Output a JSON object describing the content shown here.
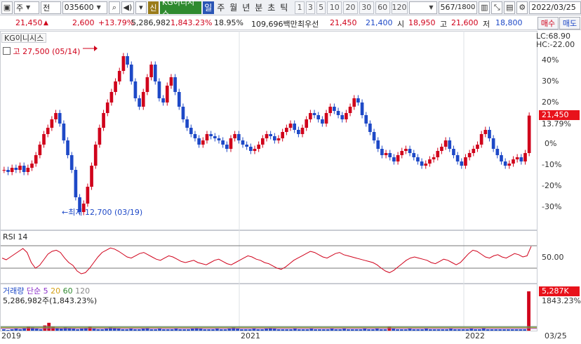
{
  "toolbar": {
    "market": "주",
    "scope": "전",
    "code": "035600",
    "badge": "신",
    "name": "KG이니시스",
    "timeframes": [
      "일",
      "주",
      "월",
      "년",
      "분",
      "초",
      "틱"
    ],
    "active_timeframe": "일",
    "periods": [
      "1",
      "3",
      "5",
      "10",
      "20",
      "30",
      "60",
      "120"
    ],
    "counter": "567",
    "counter_total": "/1800",
    "date": "2022/03/25"
  },
  "quote": {
    "price": "21,450",
    "arrow": "▲",
    "change": "2,600",
    "change_pct": "+13.79%",
    "volume": "5,286,982",
    "volume_ratio": "1,843.23%",
    "turnover": "18.95%",
    "amount": "109,696백만",
    "best_label": "최우선",
    "best_ask": "21,450",
    "best_bid": "21,400",
    "open_label": "시",
    "open": "18,950",
    "high_label": "고",
    "high": "21,600",
    "low_label": "저",
    "low": "18,800",
    "buy_label": "매수",
    "sell_label": "매도"
  },
  "chart": {
    "title": "KG이니시스",
    "lc_label": "LC:68.90",
    "hc_label": "HC:-22.00",
    "high_note": "고 27,500 (05/14)",
    "low_note": "최저 12,700 (03/19)",
    "price_tag": "21,450",
    "price_pct": "13.79%",
    "price_ticks": [
      "40%",
      "30%",
      "20%",
      "10%",
      "0%",
      "-10%",
      "-20%",
      "-30%"
    ],
    "rsi_label": "RSI 14",
    "rsi_tick": "50.00",
    "volume_label": "거래량",
    "ma_label": "단순",
    "ma_periods": [
      "5",
      "20",
      "60",
      "120"
    ],
    "volume_text": "5,286,982주(1,843.23%)",
    "vol_tag": "5,287K",
    "vol_pct": "1843.23%",
    "dates": [
      "2019",
      "2021",
      "2022",
      "03/25"
    ],
    "colors": {
      "up": "#d0021b",
      "down": "#1e49c7",
      "rsi": "#d0021b",
      "ma5": "#8b2fc9",
      "ma20": "#d4a017",
      "ma60": "#2f8a2f",
      "ma120": "#888888"
    }
  },
  "chart_data": {
    "type": "candlestick",
    "price_percent_series": [
      -12,
      -13,
      -11,
      -12,
      -10,
      -13,
      -11,
      -9,
      -5,
      0,
      5,
      8,
      12,
      15,
      10,
      2,
      -5,
      -12,
      -25,
      -32,
      -28,
      -20,
      -10,
      0,
      8,
      15,
      20,
      25,
      30,
      35,
      42,
      38,
      30,
      22,
      18,
      25,
      32,
      38,
      30,
      22,
      20,
      28,
      32,
      25,
      18,
      12,
      8,
      5,
      3,
      0,
      2,
      5,
      4,
      3,
      2,
      0,
      -2,
      3,
      5,
      2,
      0,
      -1,
      -3,
      -2,
      0,
      3,
      5,
      4,
      2,
      3,
      6,
      8,
      10,
      7,
      5,
      8,
      12,
      15,
      14,
      12,
      10,
      15,
      18,
      16,
      14,
      12,
      15,
      18,
      22,
      20,
      14,
      10,
      6,
      2,
      -2,
      -5,
      -4,
      -6,
      -8,
      -5,
      -3,
      -2,
      -4,
      -6,
      -8,
      -10,
      -9,
      -7,
      -6,
      -3,
      -1,
      2,
      -2,
      -5,
      -8,
      -10,
      -6,
      -4,
      -2,
      0,
      5,
      7,
      3,
      -2,
      -5,
      -8,
      -10,
      -9,
      -7,
      -6,
      -8,
      -4,
      13.79
    ],
    "rsi_series": [
      48,
      45,
      50,
      55,
      60,
      65,
      58,
      40,
      30,
      35,
      45,
      55,
      60,
      62,
      58,
      48,
      40,
      35,
      25,
      20,
      22,
      30,
      40,
      50,
      58,
      62,
      66,
      64,
      60,
      55,
      50,
      48,
      52,
      56,
      58,
      54,
      50,
      46,
      44,
      48,
      52,
      50,
      46,
      42,
      40,
      42,
      44,
      40,
      38,
      36,
      40,
      44,
      46,
      42,
      38,
      36,
      40,
      44,
      48,
      52,
      50,
      46,
      44,
      40,
      38,
      34,
      30,
      28,
      32,
      38,
      44,
      48,
      52,
      56,
      60,
      58,
      54,
      50,
      48,
      52,
      56,
      58,
      54,
      52,
      50,
      48,
      46,
      44,
      42,
      40,
      36,
      30,
      25,
      22,
      26,
      32,
      38,
      44,
      48,
      50,
      48,
      46,
      44,
      40,
      38,
      42,
      46,
      44,
      40,
      36,
      40,
      48,
      56,
      62,
      60,
      55,
      50,
      48,
      52,
      54,
      50,
      48,
      52,
      56,
      54,
      50,
      52,
      68.9
    ],
    "volume_series": [
      2,
      1,
      2,
      3,
      2,
      4,
      6,
      5,
      3,
      2,
      8,
      12,
      6,
      4,
      3,
      5,
      4,
      3,
      2,
      3,
      4,
      6,
      3,
      2,
      2,
      3,
      5,
      4,
      3,
      2,
      2,
      3,
      2,
      2,
      3,
      4,
      2,
      2,
      3,
      2,
      2,
      2,
      3,
      2,
      2,
      2,
      3,
      4,
      3,
      2,
      2,
      2,
      3,
      2,
      2,
      3,
      5,
      3,
      2,
      2,
      2,
      3,
      2,
      2,
      3,
      4,
      3,
      2,
      2,
      2,
      2,
      3,
      2,
      2,
      2,
      3,
      2,
      2,
      2,
      2,
      3,
      2,
      2,
      3,
      2,
      2,
      2,
      2,
      3,
      2,
      2,
      3,
      2,
      2,
      6,
      3,
      2,
      2,
      2,
      3,
      2,
      2,
      2,
      3,
      2,
      2,
      2,
      2,
      2,
      3,
      2,
      2,
      2,
      2,
      3,
      2,
      2,
      4,
      2,
      2,
      2,
      2,
      2,
      2,
      2,
      2,
      2,
      2,
      60
    ]
  }
}
